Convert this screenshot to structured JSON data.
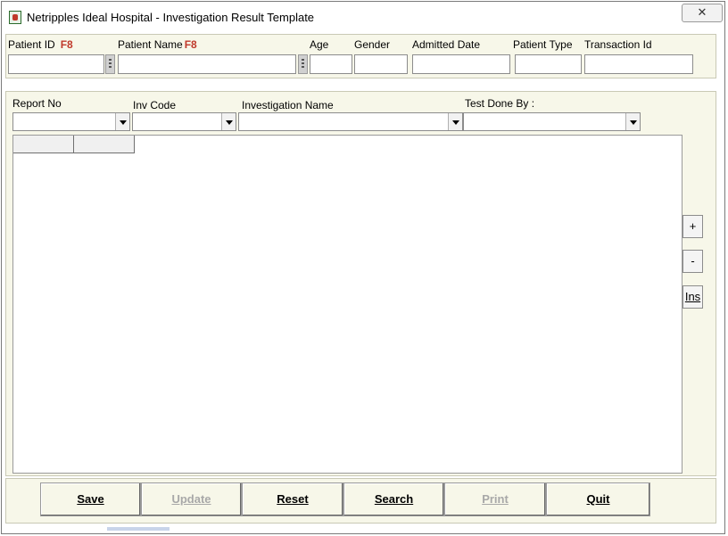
{
  "window": {
    "title": "Netripples Ideal Hospital  - Investigation Result Template",
    "close_label": "✕"
  },
  "patient": {
    "patient_id_label": "Patient ID",
    "patient_id_shortcut": "F8",
    "patient_id_value": "",
    "patient_name_label": "Patient Name",
    "patient_name_shortcut": "F8",
    "patient_name_value": "",
    "age_label": "Age",
    "age_value": "",
    "gender_label": "Gender",
    "gender_value": "",
    "admitted_date_label": "Admitted Date",
    "admitted_date_value": "",
    "patient_type_label": "Patient Type",
    "patient_type_value": "",
    "transaction_id_label": "Transaction Id",
    "transaction_id_value": ""
  },
  "investigation": {
    "report_no_label": "Report No",
    "report_no_value": "",
    "inv_code_label": "Inv Code",
    "inv_code_value": "",
    "investigation_name_label": "Investigation Name",
    "investigation_name_value": "",
    "test_done_by_label": "Test Done By :",
    "test_done_by_value": ""
  },
  "side_buttons": {
    "add": "+",
    "remove": "-",
    "insert": "Ins"
  },
  "actions": {
    "save": "Save",
    "update": "Update",
    "reset": "Reset",
    "search": "Search",
    "print": "Print",
    "quit": "Quit"
  },
  "colors": {
    "panel_bg": "#f7f7e9",
    "shortcut_red": "#c0392b",
    "disabled_text": "#a8a8a8"
  }
}
